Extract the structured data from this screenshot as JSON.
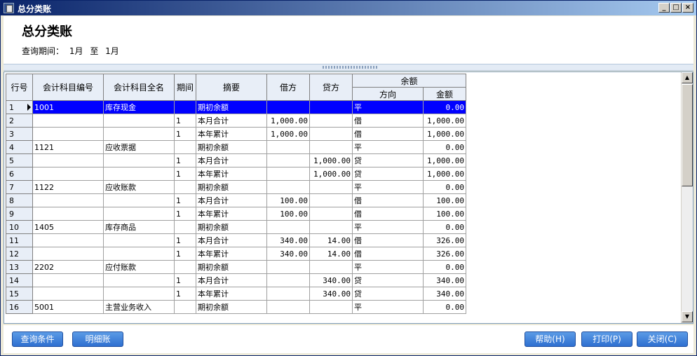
{
  "window": {
    "title": "总分类账"
  },
  "header": {
    "title": "总分类账",
    "period_label": "查询期间：",
    "period_from": "1月",
    "period_sep": "至",
    "period_to": "1月"
  },
  "table": {
    "columns": {
      "row_no": "行号",
      "account_code": "会计科目编号",
      "account_name": "会计科目全名",
      "period": "期间",
      "summary": "摘要",
      "debit": "借方",
      "credit": "贷方",
      "balance": "余额",
      "direction": "方向",
      "amount": "金额"
    },
    "rows": [
      {
        "no": "1",
        "code": "1001",
        "name": "库存现金",
        "period": "",
        "summary": "期初余额",
        "debit": "",
        "credit": "",
        "direction": "平",
        "amount": "0.00"
      },
      {
        "no": "2",
        "code": "",
        "name": "",
        "period": "1",
        "summary": "本月合计",
        "debit": "1,000.00",
        "credit": "",
        "direction": "借",
        "amount": "1,000.00"
      },
      {
        "no": "3",
        "code": "",
        "name": "",
        "period": "1",
        "summary": "本年累计",
        "debit": "1,000.00",
        "credit": "",
        "direction": "借",
        "amount": "1,000.00"
      },
      {
        "no": "4",
        "code": "1121",
        "name": "应收票据",
        "period": "",
        "summary": "期初余额",
        "debit": "",
        "credit": "",
        "direction": "平",
        "amount": "0.00"
      },
      {
        "no": "5",
        "code": "",
        "name": "",
        "period": "1",
        "summary": "本月合计",
        "debit": "",
        "credit": "1,000.00",
        "direction": "贷",
        "amount": "1,000.00"
      },
      {
        "no": "6",
        "code": "",
        "name": "",
        "period": "1",
        "summary": "本年累计",
        "debit": "",
        "credit": "1,000.00",
        "direction": "贷",
        "amount": "1,000.00"
      },
      {
        "no": "7",
        "code": "1122",
        "name": "应收账款",
        "period": "",
        "summary": "期初余额",
        "debit": "",
        "credit": "",
        "direction": "平",
        "amount": "0.00"
      },
      {
        "no": "8",
        "code": "",
        "name": "",
        "period": "1",
        "summary": "本月合计",
        "debit": "100.00",
        "credit": "",
        "direction": "借",
        "amount": "100.00"
      },
      {
        "no": "9",
        "code": "",
        "name": "",
        "period": "1",
        "summary": "本年累计",
        "debit": "100.00",
        "credit": "",
        "direction": "借",
        "amount": "100.00"
      },
      {
        "no": "10",
        "code": "1405",
        "name": "库存商品",
        "period": "",
        "summary": "期初余额",
        "debit": "",
        "credit": "",
        "direction": "平",
        "amount": "0.00"
      },
      {
        "no": "11",
        "code": "",
        "name": "",
        "period": "1",
        "summary": "本月合计",
        "debit": "340.00",
        "credit": "14.00",
        "direction": "借",
        "amount": "326.00"
      },
      {
        "no": "12",
        "code": "",
        "name": "",
        "period": "1",
        "summary": "本年累计",
        "debit": "340.00",
        "credit": "14.00",
        "direction": "借",
        "amount": "326.00"
      },
      {
        "no": "13",
        "code": "2202",
        "name": "应付账款",
        "period": "",
        "summary": "期初余额",
        "debit": "",
        "credit": "",
        "direction": "平",
        "amount": "0.00"
      },
      {
        "no": "14",
        "code": "",
        "name": "",
        "period": "1",
        "summary": "本月合计",
        "debit": "",
        "credit": "340.00",
        "direction": "贷",
        "amount": "340.00"
      },
      {
        "no": "15",
        "code": "",
        "name": "",
        "period": "1",
        "summary": "本年累计",
        "debit": "",
        "credit": "340.00",
        "direction": "贷",
        "amount": "340.00"
      },
      {
        "no": "16",
        "code": "5001",
        "name": "主营业务收入",
        "period": "",
        "summary": "期初余额",
        "debit": "",
        "credit": "",
        "direction": "平",
        "amount": "0.00"
      }
    ],
    "selected_row": 0
  },
  "buttons": {
    "query": "查询条件",
    "detail": "明细账",
    "help": "帮助(H)",
    "print": "打印(P)",
    "close": "关闭(C)"
  },
  "colors": {
    "selection": "#0000ff",
    "titlebar": "#0a246a",
    "button": "#2e6fd0"
  },
  "icons": {
    "window_minimize": "_",
    "window_maximize": "□",
    "window_close": "×",
    "scroll_up": "▲",
    "scroll_down": "▼"
  }
}
